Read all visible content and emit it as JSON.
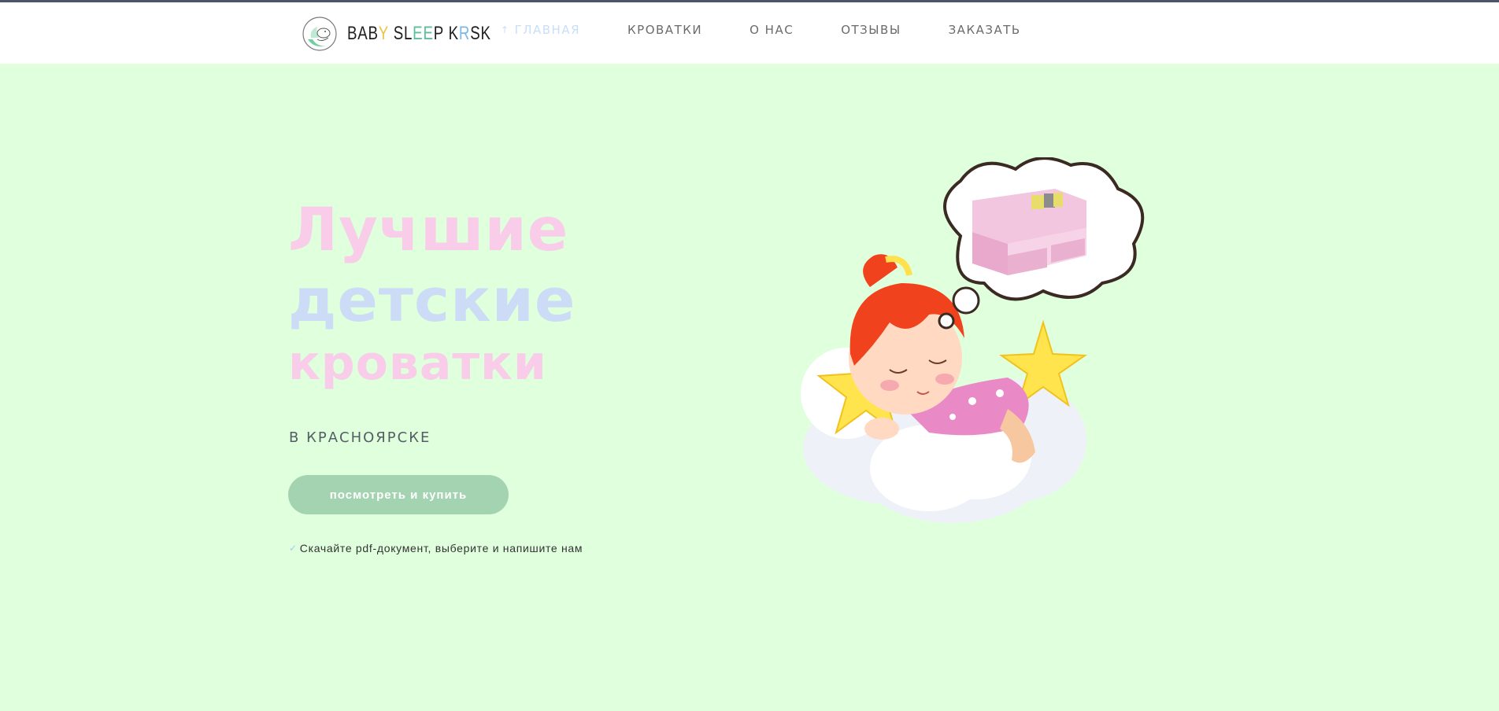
{
  "header": {
    "logo_text_parts": [
      "BAB",
      "Y",
      " SL",
      "EE",
      "P K",
      "R",
      "SK"
    ],
    "nav": [
      {
        "label": "ГЛАВНАЯ",
        "active": true
      },
      {
        "label": "КРОВАТКИ",
        "active": false
      },
      {
        "label": "О НАС",
        "active": false
      },
      {
        "label": "ОТЗЫВЫ",
        "active": false
      },
      {
        "label": "ЗАКАЗАТЬ",
        "active": false
      }
    ]
  },
  "hero": {
    "title_line1": "Лучшие",
    "title_line2": "детские",
    "title_line3": "кроватки",
    "subtitle": "В КРАСНОЯРСКЕ",
    "cta_label": "посмотреть и купить",
    "note": "Скачайте pdf-документ, выберите и напишите нам"
  },
  "colors": {
    "background": "#dfffdd",
    "title_pink": "#f9cce9",
    "title_blue": "#ccdcf6",
    "button": "#a4d3b2",
    "active_nav": "#c9def7"
  },
  "icons": {
    "logo": "baby-sleeping-moon-icon",
    "note_check": "check-icon",
    "nav_active": "arrow-up-icon"
  }
}
